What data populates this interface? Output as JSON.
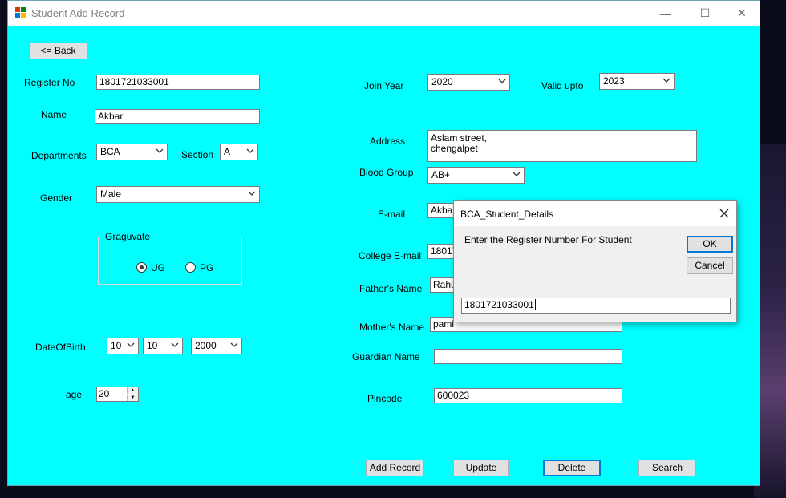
{
  "window": {
    "title": "Student Add Record",
    "minimize_glyph": "—",
    "maximize_glyph": "☐",
    "close_glyph": "✕"
  },
  "colors": {
    "form_bg": "#00ffff",
    "accent": "#0078d7"
  },
  "form": {
    "back_button": "<= Back",
    "register_no": {
      "label": "Register No",
      "value": "1801721033001"
    },
    "name": {
      "label": "Name",
      "value": "Akbar"
    },
    "department": {
      "label": "Departments",
      "value": "BCA"
    },
    "section": {
      "label": "Section",
      "value": "A"
    },
    "gender": {
      "label": "Gender",
      "value": "Male"
    },
    "graduate": {
      "title": "Graguvate",
      "ug": "UG",
      "pg": "PG",
      "selected": "UG"
    },
    "dob": {
      "label": "DateOfBirth",
      "day": "10",
      "month": "10",
      "year": "2000"
    },
    "age": {
      "label": "age",
      "value": "20"
    },
    "join_year": {
      "label": "Join Year",
      "value": "2020"
    },
    "valid_upto": {
      "label": "Valid upto",
      "value": "2023"
    },
    "address": {
      "label": "Address",
      "line1": "Aslam street,",
      "line2": "chengalpet"
    },
    "blood_group": {
      "label": "Blood Group",
      "value": "AB+"
    },
    "email": {
      "label": "E-mail",
      "value": "Akbar"
    },
    "college_email": {
      "label": "College E-mail",
      "value": "18017"
    },
    "father_name": {
      "label": "Father's Name",
      "value": "Rahu"
    },
    "mother_name": {
      "label": "Mother's Name",
      "value": "pami"
    },
    "guardian_name": {
      "label": "Guardian Name",
      "value": ""
    },
    "pincode": {
      "label": "Pincode",
      "value": "600023"
    },
    "actions": {
      "add": "Add Record",
      "update": "Update",
      "delete": "Delete",
      "search": "Search"
    }
  },
  "dialog": {
    "title": "BCA_Student_Details",
    "prompt": "Enter the Register Number For Student",
    "ok": "OK",
    "cancel": "Cancel",
    "input_value": "1801721033001"
  }
}
